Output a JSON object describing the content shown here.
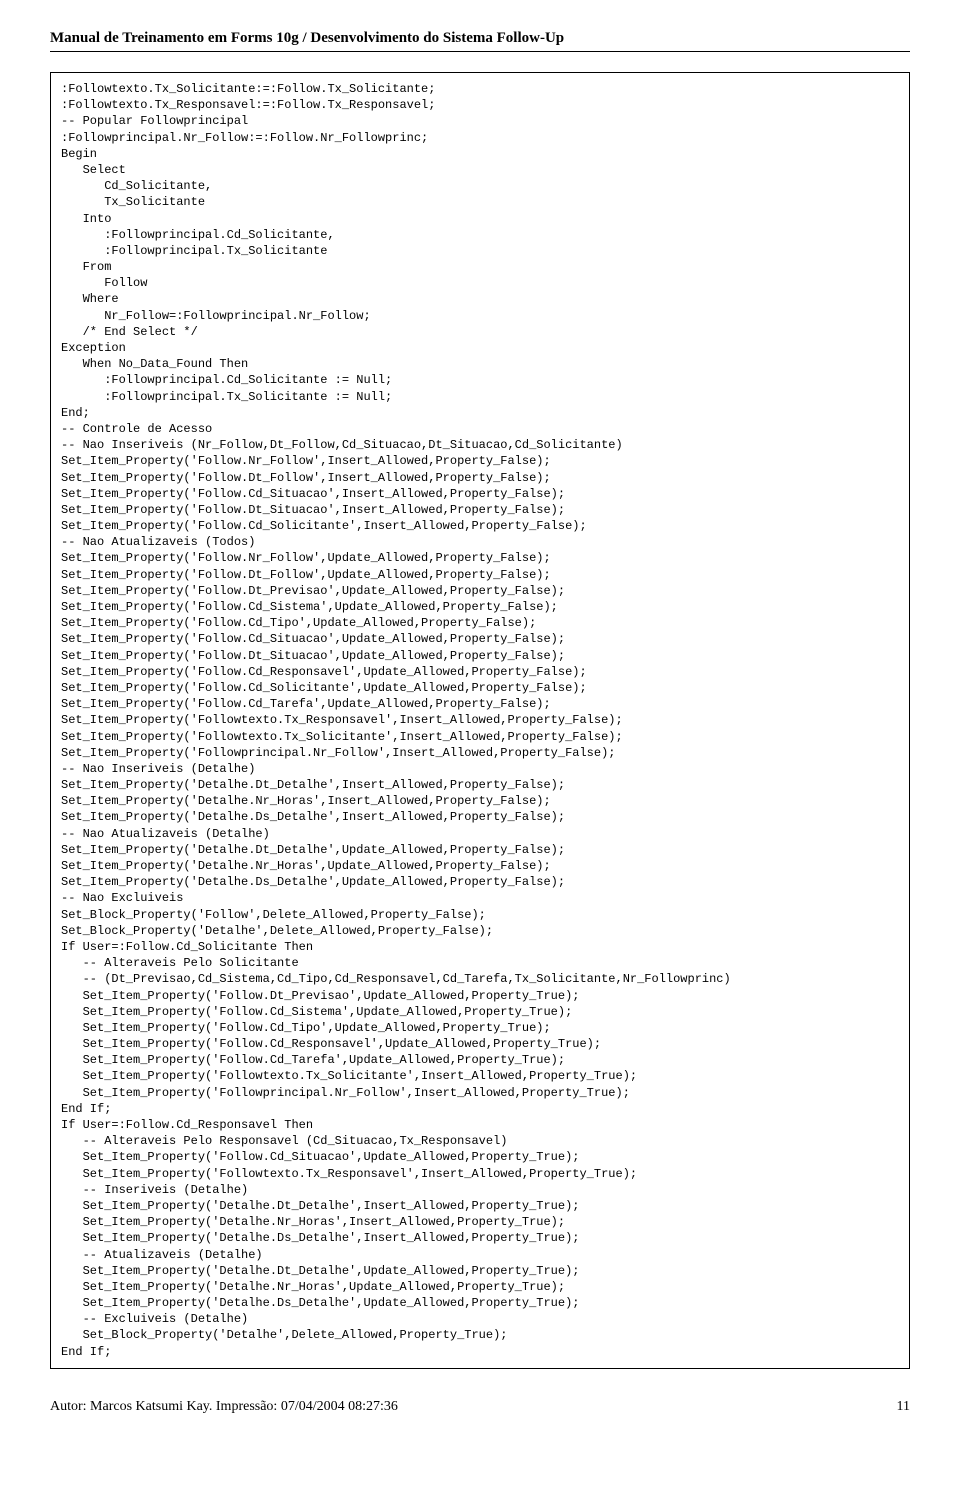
{
  "header": {
    "title": "Manual de Treinamento em Forms 10g / Desenvolvimento do Sistema Follow-Up"
  },
  "code": {
    "content": ":Followtexto.Tx_Solicitante:=:Follow.Tx_Solicitante;\n:Followtexto.Tx_Responsavel:=:Follow.Tx_Responsavel;\n-- Popular Followprincipal\n:Followprincipal.Nr_Follow:=:Follow.Nr_Followprinc;\nBegin\n   Select\n      Cd_Solicitante,\n      Tx_Solicitante\n   Into\n      :Followprincipal.Cd_Solicitante,\n      :Followprincipal.Tx_Solicitante\n   From\n      Follow\n   Where\n      Nr_Follow=:Followprincipal.Nr_Follow;\n   /* End Select */\nException\n   When No_Data_Found Then\n      :Followprincipal.Cd_Solicitante := Null;\n      :Followprincipal.Tx_Solicitante := Null;\nEnd;\n-- Controle de Acesso\n-- Nao Inseriveis (Nr_Follow,Dt_Follow,Cd_Situacao,Dt_Situacao,Cd_Solicitante)\nSet_Item_Property('Follow.Nr_Follow',Insert_Allowed,Property_False);\nSet_Item_Property('Follow.Dt_Follow',Insert_Allowed,Property_False);\nSet_Item_Property('Follow.Cd_Situacao',Insert_Allowed,Property_False);\nSet_Item_Property('Follow.Dt_Situacao',Insert_Allowed,Property_False);\nSet_Item_Property('Follow.Cd_Solicitante',Insert_Allowed,Property_False);\n-- Nao Atualizaveis (Todos)\nSet_Item_Property('Follow.Nr_Follow',Update_Allowed,Property_False);\nSet_Item_Property('Follow.Dt_Follow',Update_Allowed,Property_False);\nSet_Item_Property('Follow.Dt_Previsao',Update_Allowed,Property_False);\nSet_Item_Property('Follow.Cd_Sistema',Update_Allowed,Property_False);\nSet_Item_Property('Follow.Cd_Tipo',Update_Allowed,Property_False);\nSet_Item_Property('Follow.Cd_Situacao',Update_Allowed,Property_False);\nSet_Item_Property('Follow.Dt_Situacao',Update_Allowed,Property_False);\nSet_Item_Property('Follow.Cd_Responsavel',Update_Allowed,Property_False);\nSet_Item_Property('Follow.Cd_Solicitante',Update_Allowed,Property_False);\nSet_Item_Property('Follow.Cd_Tarefa',Update_Allowed,Property_False);\nSet_Item_Property('Followtexto.Tx_Responsavel',Insert_Allowed,Property_False);\nSet_Item_Property('Followtexto.Tx_Solicitante',Insert_Allowed,Property_False);\nSet_Item_Property('Followprincipal.Nr_Follow',Insert_Allowed,Property_False);\n-- Nao Inseriveis (Detalhe)\nSet_Item_Property('Detalhe.Dt_Detalhe',Insert_Allowed,Property_False);\nSet_Item_Property('Detalhe.Nr_Horas',Insert_Allowed,Property_False);\nSet_Item_Property('Detalhe.Ds_Detalhe',Insert_Allowed,Property_False);\n-- Nao Atualizaveis (Detalhe)\nSet_Item_Property('Detalhe.Dt_Detalhe',Update_Allowed,Property_False);\nSet_Item_Property('Detalhe.Nr_Horas',Update_Allowed,Property_False);\nSet_Item_Property('Detalhe.Ds_Detalhe',Update_Allowed,Property_False);\n-- Nao Excluiveis\nSet_Block_Property('Follow',Delete_Allowed,Property_False);\nSet_Block_Property('Detalhe',Delete_Allowed,Property_False);\nIf User=:Follow.Cd_Solicitante Then\n   -- Alteraveis Pelo Solicitante\n   -- (Dt_Previsao,Cd_Sistema,Cd_Tipo,Cd_Responsavel,Cd_Tarefa,Tx_Solicitante,Nr_Followprinc)\n   Set_Item_Property('Follow.Dt_Previsao',Update_Allowed,Property_True);\n   Set_Item_Property('Follow.Cd_Sistema',Update_Allowed,Property_True);\n   Set_Item_Property('Follow.Cd_Tipo',Update_Allowed,Property_True);\n   Set_Item_Property('Follow.Cd_Responsavel',Update_Allowed,Property_True);\n   Set_Item_Property('Follow.Cd_Tarefa',Update_Allowed,Property_True);\n   Set_Item_Property('Followtexto.Tx_Solicitante',Insert_Allowed,Property_True);\n   Set_Item_Property('Followprincipal.Nr_Follow',Insert_Allowed,Property_True);\nEnd If;\nIf User=:Follow.Cd_Responsavel Then\n   -- Alteraveis Pelo Responsavel (Cd_Situacao,Tx_Responsavel)\n   Set_Item_Property('Follow.Cd_Situacao',Update_Allowed,Property_True);\n   Set_Item_Property('Followtexto.Tx_Responsavel',Insert_Allowed,Property_True);\n   -- Inseriveis (Detalhe)\n   Set_Item_Property('Detalhe.Dt_Detalhe',Insert_Allowed,Property_True);\n   Set_Item_Property('Detalhe.Nr_Horas',Insert_Allowed,Property_True);\n   Set_Item_Property('Detalhe.Ds_Detalhe',Insert_Allowed,Property_True);\n   -- Atualizaveis (Detalhe)\n   Set_Item_Property('Detalhe.Dt_Detalhe',Update_Allowed,Property_True);\n   Set_Item_Property('Detalhe.Nr_Horas',Update_Allowed,Property_True);\n   Set_Item_Property('Detalhe.Ds_Detalhe',Update_Allowed,Property_True);\n   -- Excluiveis (Detalhe)\n   Set_Block_Property('Detalhe',Delete_Allowed,Property_True);\nEnd If;"
  },
  "footer": {
    "author_line": "Autor: Marcos Katsumi Kay. Impressão: 07/04/2004 08:27:36",
    "page_number": "11"
  }
}
